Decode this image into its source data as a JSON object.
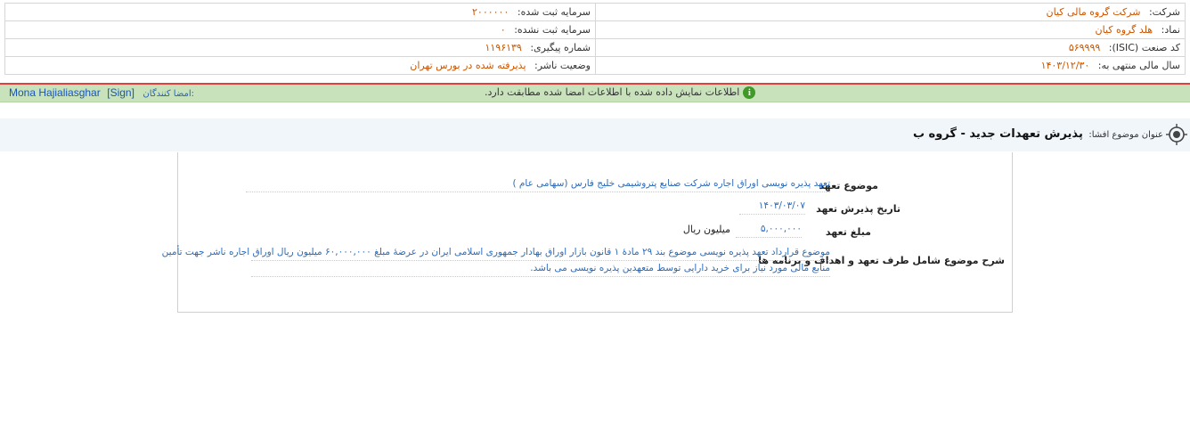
{
  "company_info": {
    "company_label": "شرکت:",
    "company_value": "شرکت گروه مالی کیان",
    "symbol_label": "نماد:",
    "symbol_value": "هلد گروه کیان",
    "isic_label": "کد صنعت (ISIC):",
    "isic_value": "۵۶۹۹۹۹",
    "fiscal_year_label": "سال مالی منتهی به:",
    "fiscal_year_value": "۱۴۰۳/۱۲/۳۰",
    "registered_capital_label": "سرمایه ثبت شده:",
    "registered_capital_value": "۲۰۰۰۰۰۰",
    "unregistered_capital_label": "سرمایه ثبت نشده:",
    "unregistered_capital_value": "۰",
    "tracking_label": "شماره پیگیری:",
    "tracking_value": "۱۱۹۶۱۳۹",
    "publisher_status_label": "وضعیت ناشر:",
    "publisher_status_value": "پذیرفته شده در بورس تهران"
  },
  "verification": {
    "signers_label": "امضا کنندگان:",
    "signer_name": "Mona Hajialiasghar",
    "sign_tag": "[Sign]",
    "message": "اطلاعات نمایش داده شده با اطلاعات امضا شده مطابقت دارد.",
    "info_glyph": "i"
  },
  "topic": {
    "label": "عنوان موضوع افشا:",
    "title": "پذیرش تعهدات جدید - گروه ب"
  },
  "commitment": {
    "subject_label": "موضوع تعهد",
    "subject_value": "تعهد پذیره نویسی اوراق اجاره شرکت صنایع پتروشیمی خلیج فارس (سهامی عام )",
    "date_label": "تاریخ پذیرش تعهد",
    "date_value": "۱۴۰۳/۰۳/۰۷",
    "amount_label": "مبلغ تعهد",
    "amount_value": "۵,۰۰۰,۰۰۰",
    "amount_unit": "میلیون ریال",
    "description_label": "شرح موضوع شامل طرف تعهد و اهداف و برنامه ها",
    "description_line1": "موضوع قرارداد تعهد پذیره نویسی موضوع بند ۲۹ مادهٔ ۱ قانون بازار اوراق بهادار جمهوری اسلامی ایران در عرضهٔ مبلغ ۶۰,۰۰۰,۰۰۰ میلیون ریال اوراق اجاره ناشر جهت تأمین",
    "description_line2": "منابع مالی مورد نیاز برای خرید دارایی توسط متعهدین پذیره نویسی می باشد."
  },
  "colors": {
    "value_orange": "#cc5500",
    "link_blue": "#2d6bb8",
    "green_bar": "#c8e3bb",
    "red_rule": "#e0413b",
    "info_green": "#3f9a27"
  }
}
